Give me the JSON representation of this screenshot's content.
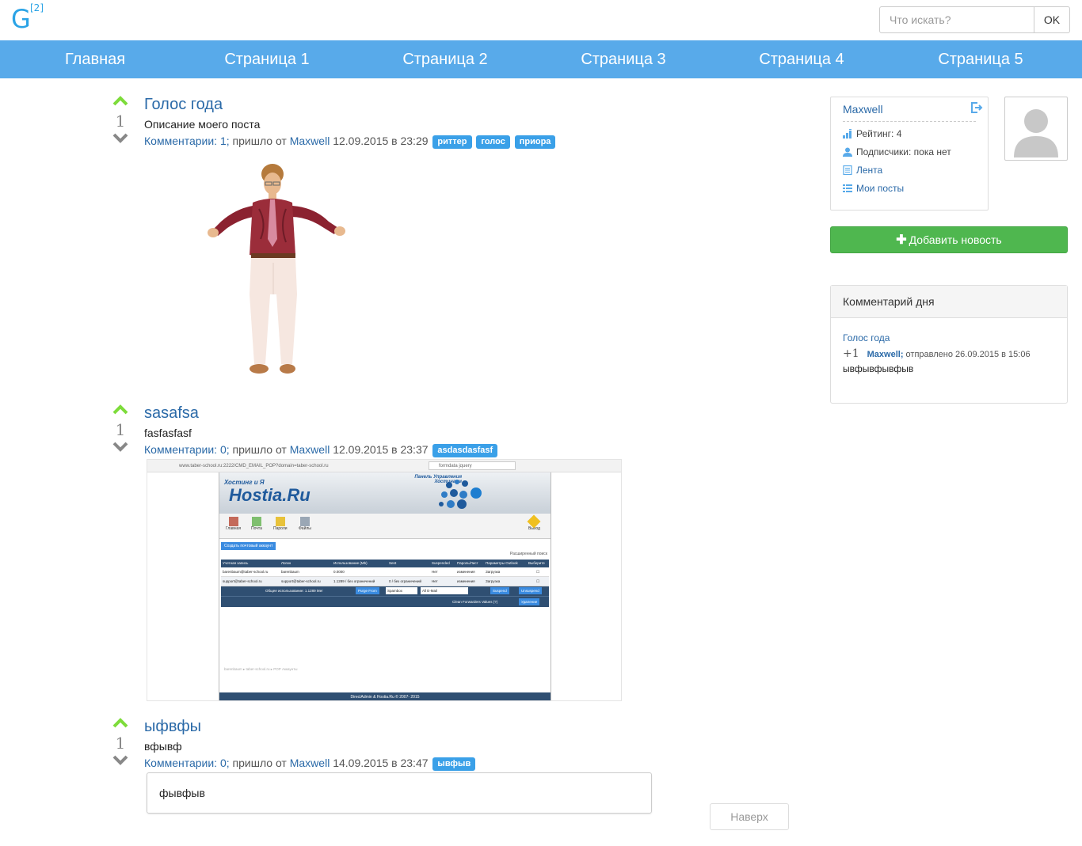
{
  "header": {
    "logo": "G",
    "logo_sup": "[2]",
    "search_placeholder": "Что искать?",
    "search_button": "OK"
  },
  "nav": [
    "Главная",
    "Страница 1",
    "Страница 2",
    "Страница 3",
    "Страница 4",
    "Страница 5"
  ],
  "posts": [
    {
      "votes": "1",
      "title": "Голос года",
      "desc": "Описание моего поста",
      "comments": "Комментарии: 1;",
      "from": " пришло от ",
      "author": "Maxwell",
      "date": " 12.09.2015 в 23:29",
      "tags": [
        "риттер",
        "голос",
        "приора"
      ]
    },
    {
      "votes": "1",
      "title": "sasafsa",
      "desc": "fasfasfasf",
      "comments": "Комментарии: 0;",
      "from": " пришло от ",
      "author": "Maxwell",
      "date": " 12.09.2015 в 23:37",
      "tags": [
        "asdasdasfasf"
      ]
    },
    {
      "votes": "1",
      "title": "ыфвфы",
      "desc": "вфывф",
      "comments": "Комментарии: 0;",
      "from": " пришло от ",
      "author": "Maxwell",
      "date": " 14.09.2015 в 23:47",
      "tags": [
        "ывфыв"
      ],
      "comment_text": "фывфыв"
    }
  ],
  "screenshot": {
    "url": "www.taber-school.ru:2222/CMD_EMAIL_POP?domain=taber-school.ru",
    "search": "formdata jquery",
    "brand_top": "Хостинг и Я",
    "brand": "Hostia.Ru",
    "panel_title": "Панель Управления Хостингом",
    "toolbar": [
      "Главная",
      "Почта",
      "Пароли",
      "Файлы"
    ],
    "exit": "Выход",
    "create_btn": "Создать почтовый аккаунт",
    "ext": "Расширенный поиск",
    "headers": [
      "Учетная запись",
      "Логин",
      "Использование (Mb)",
      "Sent",
      "Suspended",
      "Пароль/Лист",
      "Параметры Outlook",
      "Выберите"
    ],
    "rows": [
      [
        "barenbaum@taber-school.ru",
        "barenbaum",
        "0.0000",
        "",
        "Нет",
        "изменения",
        "Загрузка"
      ],
      [
        "support@taber-school.ru",
        "support@taber-school.ru",
        "1.1289 / без ограничений",
        "0 / без ограничений",
        "Нет",
        "изменения",
        "Загрузка"
      ]
    ],
    "usage": "Общее использование: 1.1289 Мег",
    "purge": "Purge From",
    "spambox": "Spambox",
    "allmail": "All E-Mail",
    "suspend": "Suspend",
    "unsuspend": "Unsuspend",
    "clean": "Clean Forwarders Values (?)",
    "delete": "Удаление",
    "crumbs": "barenbaum ▸ taber-school.ru ▸ POP Аккаунты",
    "footer": "DirectAdmin & Hostia.Ru © 2007- 2015"
  },
  "top_button": "Наверх",
  "sidebar": {
    "username": "Maxwell",
    "rating": "Рейтинг: 4",
    "subscribers": "Подписчики: пока нет",
    "feed": "Лента",
    "my_posts": "Мои посты",
    "add_news": "Добавить новость",
    "comment_of_day": {
      "header": "Комментарий дня",
      "post_title": "Голос года",
      "score": "+1",
      "author": "Maxwell;",
      "sent": " отправлено 26.09.2015 в 15:06",
      "text": "ывфывфывфыв"
    }
  },
  "colors": {
    "nav_bg": "#58aaea",
    "link": "#2b6aa8",
    "tag": "#3aa0e8",
    "up_arrow": "#7ddc3a",
    "down_arrow": "#888888",
    "add_button": "#4fb74f"
  }
}
